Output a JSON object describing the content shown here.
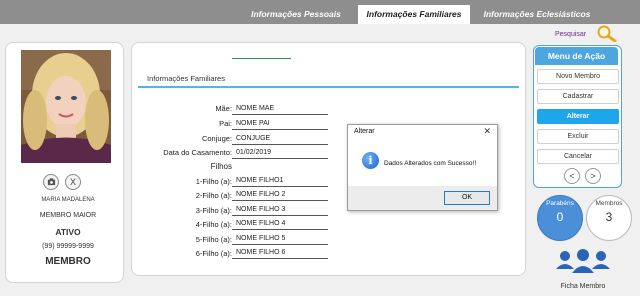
{
  "tabs": [
    {
      "label": "Informações Pessoais",
      "active": false
    },
    {
      "label": "Informações Familiares",
      "active": true
    },
    {
      "label": "Informações Eclesiásticos",
      "active": false
    }
  ],
  "profile": {
    "name": "MARIA MADALENA",
    "role": "MEMBRO MAIOR",
    "status": "ATIVO",
    "phone": "(99) 99999-9999",
    "type": "MEMBRO",
    "camera_icon": "camera-icon",
    "remove_label": "X"
  },
  "family": {
    "section_title": "Informações Familiares",
    "fields": [
      {
        "label": "Mãe:",
        "value": "NOME MAE"
      },
      {
        "label": "Pai:",
        "value": "NOME PAI"
      },
      {
        "label": "Conjuge:",
        "value": "CONJUGE"
      },
      {
        "label": "Data do Casamento:",
        "value": "01/02/2019"
      }
    ],
    "children_title": "Filhos",
    "children": [
      {
        "label": "1-Filho (a):",
        "value": "NOME FILHO1"
      },
      {
        "label": "2-Filho (a):",
        "value": "NOME FILHO 2"
      },
      {
        "label": "3-Filho (a):",
        "value": "NOME FILHO 3"
      },
      {
        "label": "4-Filho (a):",
        "value": "NOME FILHO 4"
      },
      {
        "label": "5-Filho (a):",
        "value": "NOME FILHO 5"
      },
      {
        "label": "6-Filho (a):",
        "value": "NOME FILHO 6"
      }
    ]
  },
  "search": {
    "label": "Pesquisar",
    "icon": "magnifier-icon"
  },
  "action_menu": {
    "title": "Menu de Ação",
    "buttons": [
      "Novo Membro",
      "Cadastrar",
      "Alterar",
      "Excluir",
      "Cancelar"
    ],
    "selected": "Alterar",
    "prev": "<",
    "next": ">"
  },
  "stats": {
    "birthdays_label": "Parabéns",
    "birthdays_value": "0",
    "members_label": "Membros",
    "members_value": "3"
  },
  "member_card": {
    "label": "Ficha Membro",
    "icon": "group-users-icon"
  },
  "dialog": {
    "title": "Alterar",
    "close": "✕",
    "message": "Dados Alterados com Sucesso!!",
    "ok": "OK",
    "icon_glyph": "i"
  },
  "colors": {
    "accent_blue": "#1ea5ea",
    "stats_blue": "#4c8fd9",
    "search_purple": "#6b2d8f",
    "icon_blue": "#2a63b8",
    "topbar_gray": "#8e8e8e"
  }
}
